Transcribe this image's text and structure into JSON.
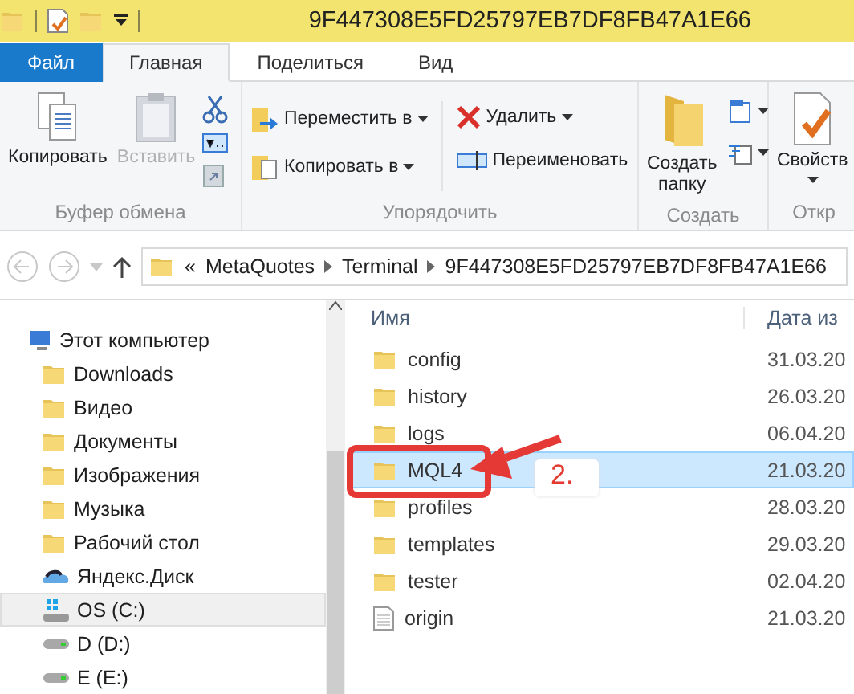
{
  "window": {
    "title": "9F447308E5FD25797EB7DF8FB47A1E66"
  },
  "tabs": [
    {
      "label": "Файл",
      "kind": "file",
      "selected": false
    },
    {
      "label": "Главная",
      "kind": "tab",
      "selected": true
    },
    {
      "label": "Поделиться",
      "kind": "tab",
      "selected": false
    },
    {
      "label": "Вид",
      "kind": "tab",
      "selected": false
    }
  ],
  "ribbon": [
    {
      "label": "Буфер обмена",
      "large": [
        {
          "label": "Копировать",
          "disabled": false
        },
        {
          "label": "Вставить",
          "disabled": true
        }
      ]
    },
    {
      "label": "Упорядочить",
      "columns": [
        [
          {
            "label": "Переместить в",
            "dropdown": true
          },
          {
            "label": "Копировать в",
            "dropdown": true
          }
        ],
        [
          {
            "label": "Удалить",
            "dropdown": true
          },
          {
            "label": "Переименовать",
            "dropdown": false
          }
        ]
      ]
    },
    {
      "label": "Создать",
      "large": [
        {
          "label": "Создать папку",
          "disabled": false
        }
      ]
    },
    {
      "label": "Откр",
      "large": [
        {
          "label": "Свойств",
          "disabled": false
        }
      ]
    }
  ],
  "address": {
    "overflow": "«",
    "crumbs": [
      "MetaQuotes",
      "Terminal",
      "9F447308E5FD25797EB7DF8FB47A1E66"
    ]
  },
  "nav": [
    {
      "label": "Этот компьютер",
      "kind": "computer",
      "selected": false,
      "children": [
        {
          "label": "Downloads",
          "kind": "downloads",
          "selected": false
        },
        {
          "label": "Видео",
          "kind": "video",
          "selected": false
        },
        {
          "label": "Документы",
          "kind": "docs",
          "selected": false
        },
        {
          "label": "Изображения",
          "kind": "images",
          "selected": false
        },
        {
          "label": "Музыка",
          "kind": "music",
          "selected": false
        },
        {
          "label": "Рабочий стол",
          "kind": "desktop",
          "selected": false
        },
        {
          "label": "Яндекс.Диск",
          "kind": "cloud",
          "selected": false
        },
        {
          "label": "OS (C:)",
          "kind": "system-drive",
          "selected": true
        },
        {
          "label": "D (D:)",
          "kind": "drive",
          "selected": false
        },
        {
          "label": "E (E:)",
          "kind": "drive",
          "selected": false
        }
      ]
    }
  ],
  "files": {
    "columns": [
      "Имя",
      "Дата из"
    ],
    "rows": [
      {
        "name": "config",
        "date": "31.03.20",
        "kind": "folder",
        "selected": false
      },
      {
        "name": "history",
        "date": "26.03.20",
        "kind": "folder",
        "selected": false
      },
      {
        "name": "logs",
        "date": "06.04.20",
        "kind": "folder",
        "selected": false
      },
      {
        "name": "MQL4",
        "date": "21.03.20",
        "kind": "folder",
        "selected": true
      },
      {
        "name": "profiles",
        "date": "28.03.20",
        "kind": "folder",
        "selected": false
      },
      {
        "name": "templates",
        "date": "29.03.20",
        "kind": "folder",
        "selected": false
      },
      {
        "name": "tester",
        "date": "02.04.20",
        "kind": "folder",
        "selected": false
      },
      {
        "name": "origin",
        "date": "21.03.20",
        "kind": "file",
        "selected": false
      }
    ]
  },
  "annotation": {
    "label": "2."
  }
}
